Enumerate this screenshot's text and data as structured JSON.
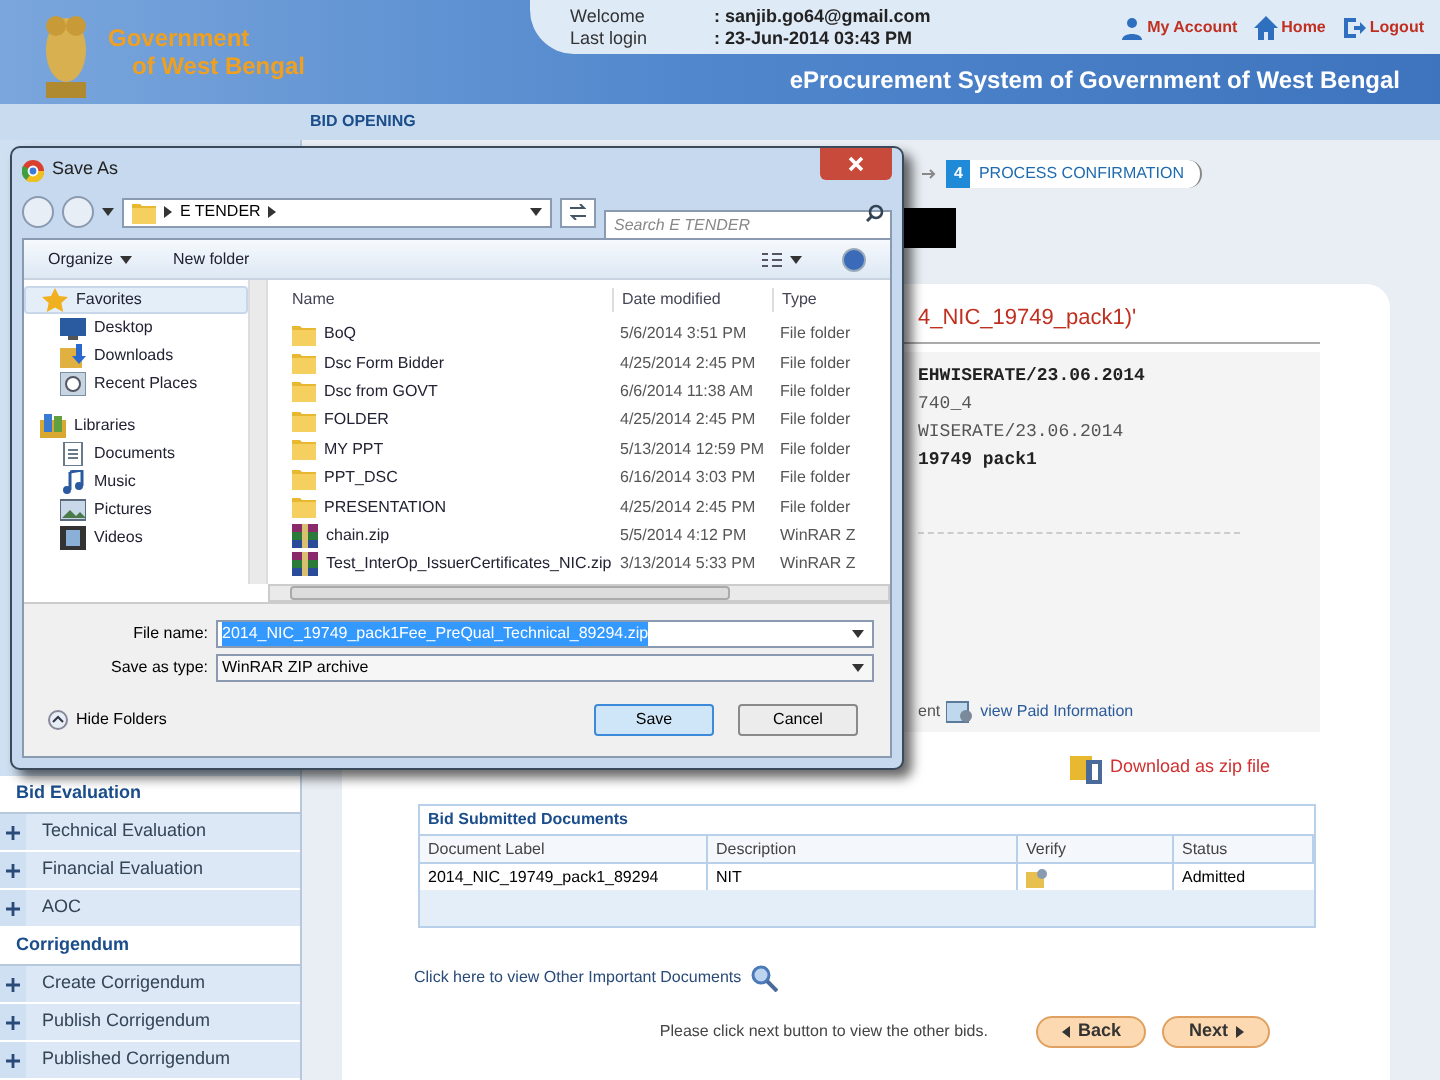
{
  "header": {
    "org_line_1": "Government",
    "org_line_2": "of West Bengal",
    "welcome_label": "Welcome",
    "welcome_value": ": sanjib.go64@gmail.com",
    "login_label": "Last login",
    "login_value": ": 23-Jun-2014 03:43 PM",
    "links": [
      {
        "label": "My Account",
        "kind": "account"
      },
      {
        "label": "Home",
        "kind": "home"
      },
      {
        "label": "Logout",
        "kind": "logout"
      }
    ],
    "system_title": "eProcurement System of Government of West Bengal"
  },
  "page_title": "BID OPENING",
  "sidebar": {
    "sections": [
      {
        "title": "Bid Evaluation",
        "items": [
          "Technical Evaluation",
          "Financial Evaluation",
          "AOC"
        ]
      },
      {
        "title": "Corrigendum",
        "items": [
          "Create Corrigendum",
          "Publish Corrigendum",
          "Published Corrigendum"
        ]
      }
    ]
  },
  "step": {
    "number": "4",
    "label": "PROCESS CONFIRMATION"
  },
  "card": {
    "title": "4_NIC_19749_pack1)'",
    "details": [
      {
        "text": "EHWISERATE/23.06.2014",
        "bold": true
      },
      {
        "text": "740_4",
        "bold": false
      },
      {
        "text": "WISERATE/23.06.2014",
        "bold": false
      },
      {
        "text": "19749 pack1",
        "bold": true
      }
    ],
    "paid_prefix": "ent",
    "paid_link": "view Paid Information"
  },
  "download_link": "Download as zip file",
  "documents": {
    "title": "Bid Submitted Documents",
    "columns": [
      "Document Label",
      "Description",
      "Verify",
      "Status"
    ],
    "rows": [
      {
        "label": "2014_NIC_19749_pack1_89294",
        "description": "NIT",
        "status": "Admitted"
      }
    ]
  },
  "other_docs_link": "Click here to view Other Important Documents",
  "hint": "Please click next button to view the other bids.",
  "back_button": "Back",
  "next_button": "Next",
  "dialog": {
    "title": "Save As",
    "path": "E TENDER",
    "search_placeholder": "Search E TENDER",
    "organize": "Organize",
    "new_folder": "New folder",
    "nav": [
      {
        "label": "Favorites",
        "kind": "star",
        "children": [
          {
            "label": "Desktop",
            "kind": "desktop"
          },
          {
            "label": "Downloads",
            "kind": "downloads"
          },
          {
            "label": "Recent Places",
            "kind": "recent"
          }
        ]
      },
      {
        "label": "Libraries",
        "kind": "library",
        "children": [
          {
            "label": "Documents",
            "kind": "documents"
          },
          {
            "label": "Music",
            "kind": "music"
          },
          {
            "label": "Pictures",
            "kind": "pictures"
          },
          {
            "label": "Videos",
            "kind": "videos"
          }
        ]
      }
    ],
    "columns": [
      "Name",
      "Date modified",
      "Type"
    ],
    "files": [
      {
        "name": "BoQ",
        "date": "5/6/2014 3:51 PM",
        "type": "File folder",
        "kind": "folder"
      },
      {
        "name": "Dsc Form Bidder",
        "date": "4/25/2014 2:45 PM",
        "type": "File folder",
        "kind": "folder"
      },
      {
        "name": "Dsc from GOVT",
        "date": "6/6/2014 11:38 AM",
        "type": "File folder",
        "kind": "folder"
      },
      {
        "name": "FOLDER",
        "date": "4/25/2014 2:45 PM",
        "type": "File folder",
        "kind": "folder"
      },
      {
        "name": "MY PPT",
        "date": "5/13/2014 12:59 PM",
        "type": "File folder",
        "kind": "folder"
      },
      {
        "name": "PPT_DSC",
        "date": "6/16/2014 3:03 PM",
        "type": "File folder",
        "kind": "folder"
      },
      {
        "name": "PRESENTATION",
        "date": "4/25/2014 2:45 PM",
        "type": "File folder",
        "kind": "folder"
      },
      {
        "name": "chain.zip",
        "date": "5/5/2014 4:12 PM",
        "type": "WinRAR Z",
        "kind": "zip"
      },
      {
        "name": "Test_InterOp_IssuerCertificates_NIC.zip",
        "date": "3/13/2014 5:33 PM",
        "type": "WinRAR Z",
        "kind": "zip"
      }
    ],
    "file_name_label": "File name:",
    "file_name": "2014_NIC_19749_pack1Fee_PreQual_Technical_89294.zip",
    "file_name_selected": true,
    "type_label": "Save as type:",
    "file_type": "WinRAR ZIP archive",
    "hide_folders": "Hide Folders",
    "save": "Save",
    "cancel": "Cancel"
  }
}
